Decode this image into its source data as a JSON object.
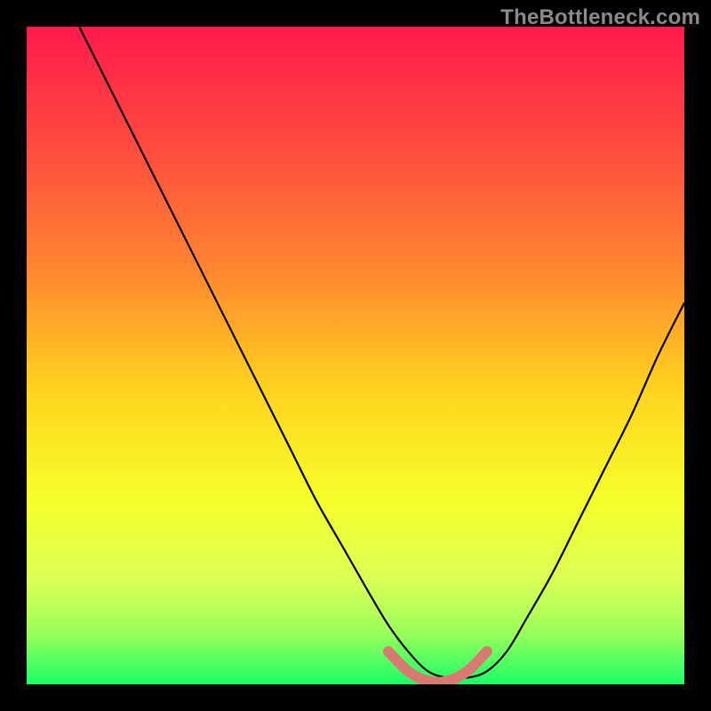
{
  "watermark": {
    "text": "TheBottleneck.com"
  },
  "chart_data": {
    "type": "line",
    "title": "",
    "xlabel": "",
    "ylabel": "",
    "xlim": [
      0,
      100
    ],
    "ylim": [
      0,
      100
    ],
    "grid": false,
    "legend": "none",
    "gradient_stops": [
      {
        "pos": 0.0,
        "color": "#ff1a4b"
      },
      {
        "pos": 0.18,
        "color": "#ff4a3f"
      },
      {
        "pos": 0.38,
        "color": "#ff8a2f"
      },
      {
        "pos": 0.55,
        "color": "#ffd21e"
      },
      {
        "pos": 0.72,
        "color": "#f6ff2a"
      },
      {
        "pos": 0.84,
        "color": "#dcff55"
      },
      {
        "pos": 0.92,
        "color": "#9cff5a"
      },
      {
        "pos": 1.0,
        "color": "#1aff66"
      }
    ],
    "series": [
      {
        "name": "bottleneck-curve",
        "color": "#000000",
        "x": [
          8,
          12,
          16,
          20,
          24,
          28,
          32,
          36,
          40,
          44,
          48,
          52,
          55,
          58,
          61,
          64,
          67,
          70,
          73,
          76,
          80,
          84,
          88,
          92,
          96,
          100
        ],
        "values": [
          100,
          92,
          84,
          76,
          68,
          60,
          52,
          44,
          36,
          28,
          21,
          14,
          9,
          5,
          2,
          1,
          1,
          2,
          5,
          10,
          17,
          25,
          33,
          41,
          50,
          58
        ]
      },
      {
        "name": "optimal-marker",
        "color": "#d97a72",
        "type": "marker-band",
        "x": [
          55,
          58,
          61,
          64,
          67,
          70
        ],
        "values": [
          5,
          2,
          0.5,
          0.5,
          2,
          5
        ]
      }
    ]
  }
}
